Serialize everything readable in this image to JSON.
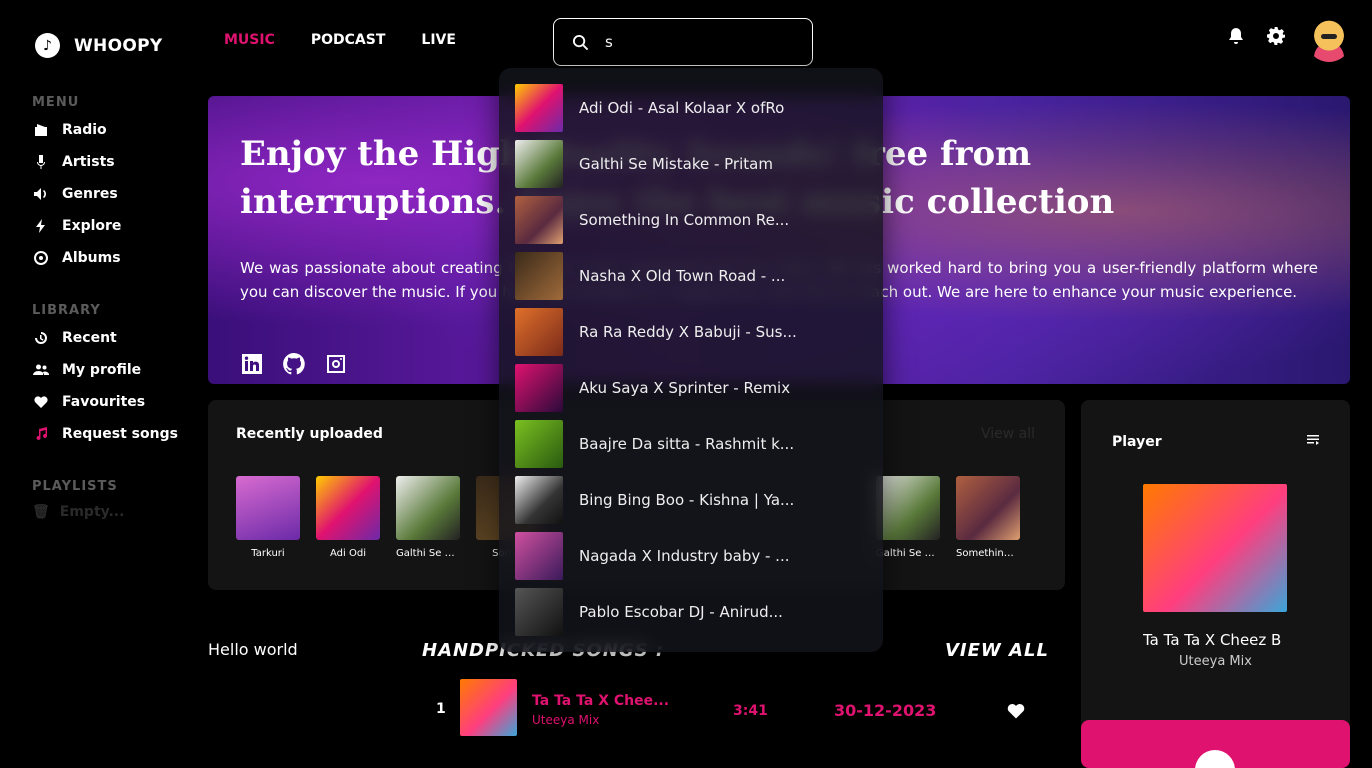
{
  "app": {
    "name": "WHOOPY"
  },
  "sidebar": {
    "menu_heading": "MENU",
    "menu_items": [
      {
        "label": "Radio",
        "icon": "radio-icon"
      },
      {
        "label": "Artists",
        "icon": "microphone-icon"
      },
      {
        "label": "Genres",
        "icon": "speaker-icon"
      },
      {
        "label": "Explore",
        "icon": "bolt-icon"
      },
      {
        "label": "Albums",
        "icon": "disc-icon"
      }
    ],
    "library_heading": "LIBRARY",
    "library_items": [
      {
        "label": "Recent",
        "icon": "history-icon"
      },
      {
        "label": "My profile",
        "icon": "users-icon"
      },
      {
        "label": "Favourites",
        "icon": "heart-icon"
      },
      {
        "label": "Request songs",
        "icon": "music-note-icon"
      }
    ],
    "playlists_heading": "PLAYLISTS",
    "playlists_empty": "Empty..."
  },
  "topnav": {
    "tabs": [
      "MUSIC",
      "PODCAST",
      "LIVE"
    ],
    "active": "MUSIC"
  },
  "search": {
    "value": "s",
    "placeholder": ""
  },
  "hero": {
    "headline": "Enjoy the High Quality Sounds! free from interruptions. Enjoy the best music collection",
    "description": "We was passionate about creating the best music experience for our users. We has worked hard to bring you a user-friendly platform where you can discover the music. If you have any feedback or suggestions, feel free to reach out. We are here to enhance your music experience."
  },
  "recent": {
    "title": "Recently uploaded",
    "view_all": "View all",
    "items": [
      "Tarkuri",
      "Adi Odi",
      "Galthi Se Mi...",
      "Som...",
      "",
      "",
      "",
      "",
      "Galthi Se Mi...",
      "Something ..."
    ]
  },
  "search_results": [
    "Adi Odi - Asal Kolaar X ofRo",
    "Galthi Se Mistake - Pritam",
    "Something In Common Re...",
    "Nasha X Old Town Road - ...",
    "Ra Ra Reddy X Babuji - Sus...",
    "Aku Saya X Sprinter - Remix",
    "Baajre Da sitta - Rashmit k...",
    "Bing Bing Boo - Kishna | Ya...",
    "Nagada X Industry baby - ...",
    "Pablo Escobar DJ - Anirud..."
  ],
  "lower": {
    "hello": "Hello world",
    "handpicked_title": "HANDPICKED SONGS :",
    "view_all": "VIEW ALL",
    "row": {
      "index": "1",
      "title": "Ta Ta Ta X Chee...",
      "artist": "Uteeya Mix",
      "duration": "3:41",
      "date": "30-12-2023"
    }
  },
  "player": {
    "title": "Player",
    "song": "Ta Ta Ta X Cheez B",
    "artist": "Uteeya Mix"
  },
  "colors": {
    "accent": "#e0126f",
    "background": "#000000",
    "panel": "#141414"
  }
}
